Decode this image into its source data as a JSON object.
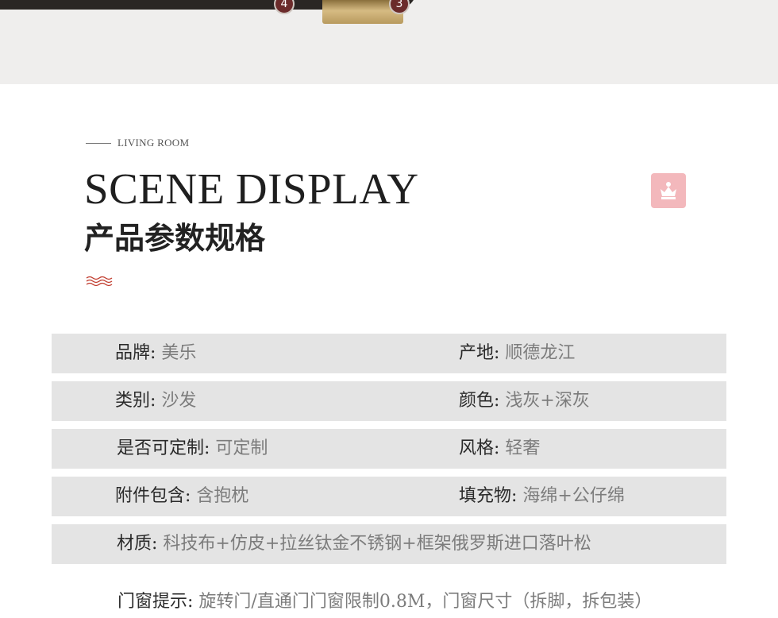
{
  "hero": {
    "markers": [
      "4",
      "3"
    ]
  },
  "section": {
    "eyebrow": "LIVING ROOM",
    "heading_en": "SCENE DISPLAY",
    "heading_cn": "产品参数规格",
    "icons": [
      "crown-icon",
      "wave-icon"
    ],
    "colors": {
      "badge": "#f3b8bc",
      "waves": "#c0392b",
      "row_bg": "#e4e4e4"
    }
  },
  "specs": {
    "brand": {
      "label": "品牌:",
      "value": "美乐"
    },
    "origin": {
      "label": "产地:",
      "value": "顺德龙江"
    },
    "category": {
      "label": "类别:",
      "value": "沙发"
    },
    "color": {
      "label": "颜色:",
      "value": "浅灰+深灰"
    },
    "customizable": {
      "label": "是否可定制:",
      "value": "可定制"
    },
    "style": {
      "label": "风格:",
      "value": "轻奢"
    },
    "accessories": {
      "label": "附件包含:",
      "value": "含抱枕"
    },
    "filling": {
      "label": "填充物:",
      "value": "海绵+公仔绵"
    },
    "material": {
      "label": "材质:",
      "value": "科技布+仿皮+拉丝钛金不锈钢+框架俄罗斯进口落叶松"
    },
    "notice": {
      "label": "门窗提示:",
      "value": "旋转门/直通门门窗限制0.8M，门窗尺寸（拆脚，拆包装）"
    }
  }
}
